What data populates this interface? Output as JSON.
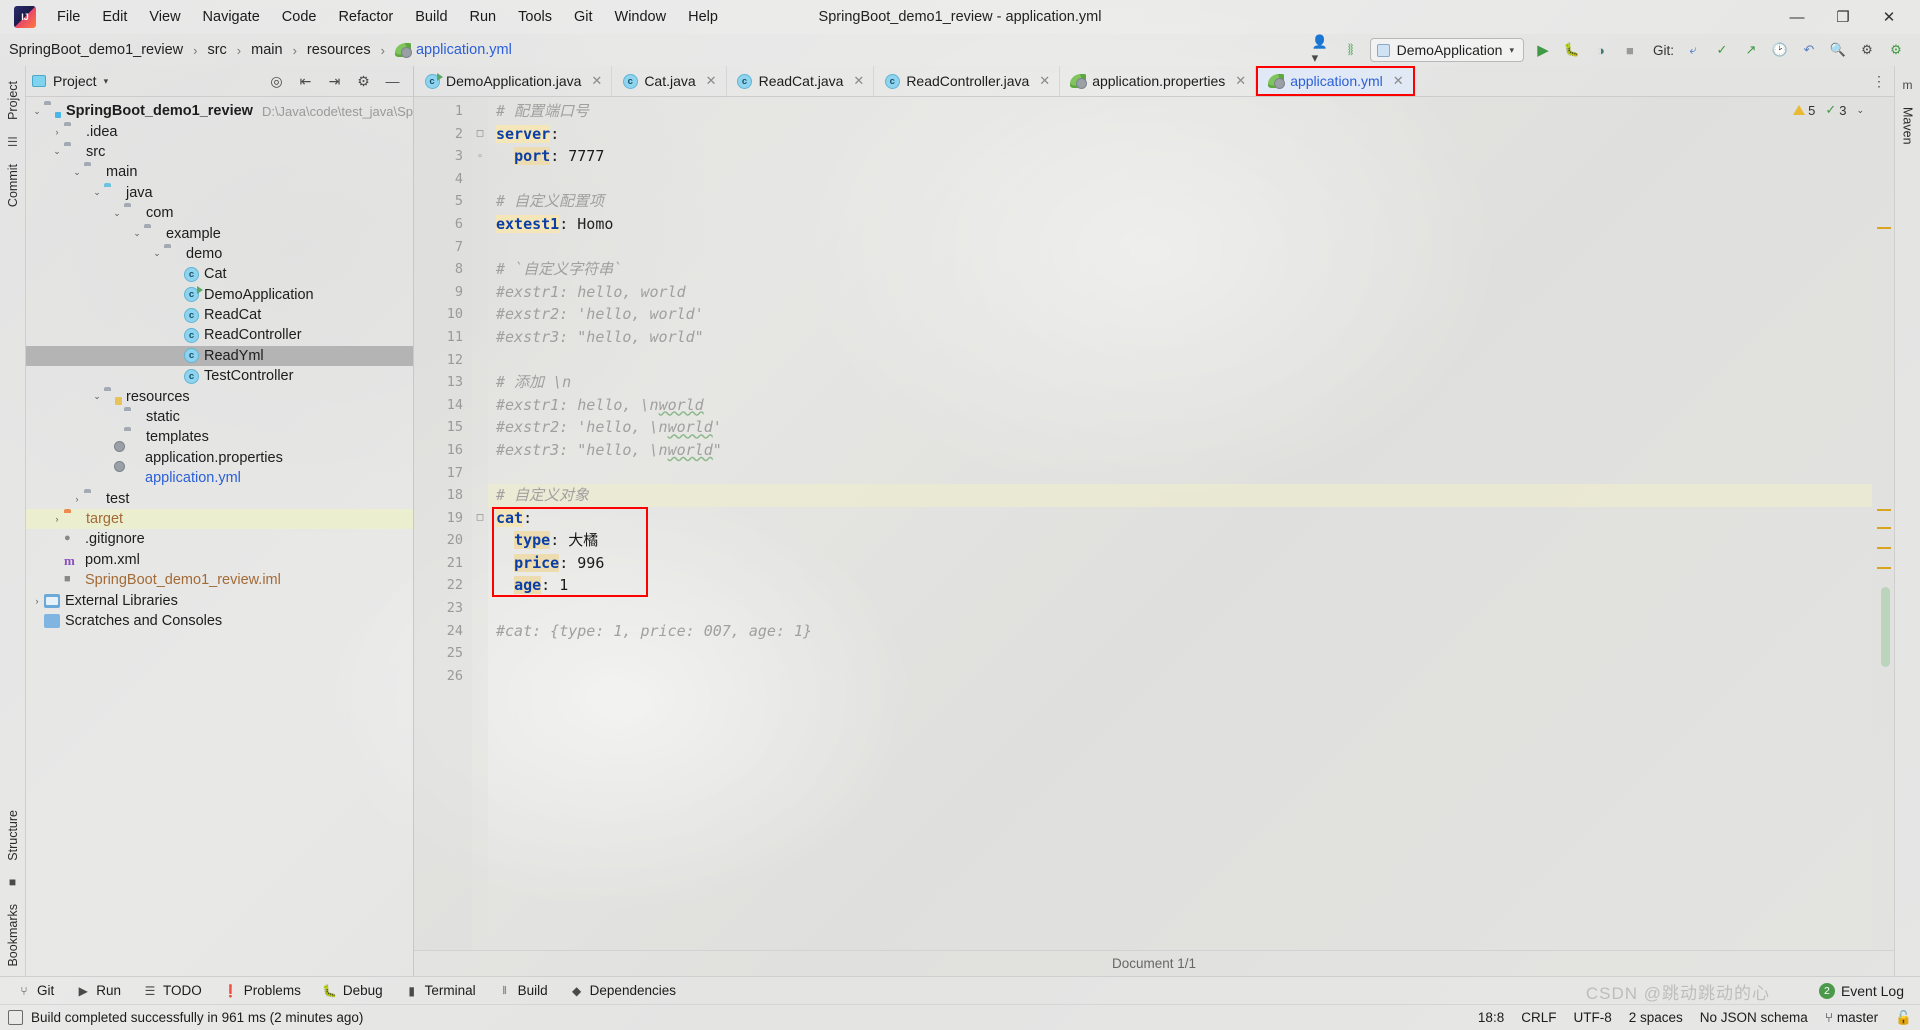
{
  "window": {
    "title": "SpringBoot_demo1_review - application.yml",
    "controls": {
      "minimize": "—",
      "maximize": "❐",
      "close": "✕"
    }
  },
  "menubar": {
    "logo": "idea-logo-icon",
    "items": [
      "File",
      "Edit",
      "View",
      "Navigate",
      "Code",
      "Refactor",
      "Build",
      "Run",
      "Tools",
      "Git",
      "Window",
      "Help"
    ]
  },
  "navbar": {
    "breadcrumbs": [
      {
        "label": "SpringBoot_demo1_review",
        "icon": "",
        "active": false
      },
      {
        "label": "src",
        "icon": "",
        "active": false
      },
      {
        "label": "main",
        "icon": "",
        "active": false
      },
      {
        "label": "resources",
        "icon": "",
        "active": false
      },
      {
        "label": "application.yml",
        "icon": "spring-leaf-icon",
        "active": true
      }
    ],
    "separator": "›",
    "profile_icon": "user-avatar-icon",
    "build_icon": "hammer-icon",
    "run_configuration": "DemoApplication",
    "run_icon": "run-play-icon",
    "debug_icon": "debug-bug-icon",
    "run_coverage_icon": "run-with-coverage-icon",
    "stop_icon": "stop-square-icon",
    "git_label": "Git:",
    "git_update_icon": "git-update-icon",
    "git_commit_icon": "git-commit-check-icon",
    "git_push_icon": "git-push-icon",
    "history_icon": "history-clock-icon",
    "undo_icon": "undo-arrow-icon",
    "search_icon": "search-magnifier-icon",
    "settings_icon": "gear-icon",
    "ide_icon": "ide-update-icon"
  },
  "left_rail": {
    "tabs": [
      "Project",
      "Commit"
    ],
    "bottom_tabs": [
      "Structure",
      "Bookmarks"
    ]
  },
  "right_rail": {
    "tabs": [
      "Maven"
    ]
  },
  "project_panel": {
    "title": "Project",
    "dropdown_icon": "chevron-down-icon",
    "header_icons": [
      "target-locate-icon",
      "expand-all-icon",
      "collapse-all-icon",
      "settings-gear-icon",
      "hide-panel-icon"
    ],
    "tree": [
      {
        "depth": 0,
        "arrow": "⌄",
        "icon": "folder-module",
        "label": "SpringBoot_demo1_review",
        "bold": true,
        "path": "D:\\Java\\code\\test_java\\SpringB…",
        "state": ""
      },
      {
        "depth": 1,
        "arrow": "›",
        "icon": "folder",
        "label": ".idea",
        "state": ""
      },
      {
        "depth": 1,
        "arrow": "⌄",
        "icon": "folder-src",
        "label": "src",
        "state": ""
      },
      {
        "depth": 2,
        "arrow": "⌄",
        "icon": "folder",
        "label": "main",
        "state": ""
      },
      {
        "depth": 3,
        "arrow": "⌄",
        "icon": "folder-blue",
        "label": "java",
        "state": ""
      },
      {
        "depth": 4,
        "arrow": "⌄",
        "icon": "folder",
        "label": "com",
        "state": ""
      },
      {
        "depth": 5,
        "arrow": "⌄",
        "icon": "folder",
        "label": "example",
        "state": ""
      },
      {
        "depth": 6,
        "arrow": "⌄",
        "icon": "folder",
        "label": "demo",
        "state": ""
      },
      {
        "depth": 7,
        "arrow": "",
        "icon": "java-class",
        "label": "Cat",
        "state": ""
      },
      {
        "depth": 7,
        "arrow": "",
        "icon": "java-class-runnable",
        "label": "DemoApplication",
        "state": ""
      },
      {
        "depth": 7,
        "arrow": "",
        "icon": "java-class",
        "label": "ReadCat",
        "state": ""
      },
      {
        "depth": 7,
        "arrow": "",
        "icon": "java-class",
        "label": "ReadController",
        "state": ""
      },
      {
        "depth": 7,
        "arrow": "",
        "icon": "java-class",
        "label": "ReadYml",
        "state": "selected"
      },
      {
        "depth": 7,
        "arrow": "",
        "icon": "java-class",
        "label": "TestController",
        "state": ""
      },
      {
        "depth": 3,
        "arrow": "⌄",
        "icon": "folder-resources",
        "label": "resources",
        "state": ""
      },
      {
        "depth": 4,
        "arrow": "",
        "icon": "folder",
        "label": "static",
        "state": ""
      },
      {
        "depth": 4,
        "arrow": "",
        "icon": "folder",
        "label": "templates",
        "state": ""
      },
      {
        "depth": 4,
        "arrow": "",
        "icon": "spring-leaf-icon",
        "label": "application.properties",
        "state": ""
      },
      {
        "depth": 4,
        "arrow": "",
        "icon": "spring-leaf-icon",
        "label": "application.yml",
        "state": "open-file"
      },
      {
        "depth": 2,
        "arrow": "›",
        "icon": "folder",
        "label": "test",
        "state": ""
      },
      {
        "depth": 1,
        "arrow": "›",
        "icon": "folder-orange",
        "label": "target",
        "state": "excluded"
      },
      {
        "depth": 1,
        "arrow": "",
        "icon": "gitignore-icon",
        "label": ".gitignore",
        "state": ""
      },
      {
        "depth": 1,
        "arrow": "",
        "icon": "maven-icon",
        "label": "pom.xml",
        "state": ""
      },
      {
        "depth": 1,
        "arrow": "",
        "icon": "iml-icon",
        "label": "SpringBoot_demo1_review.iml",
        "state": "module-file"
      },
      {
        "depth": 0,
        "arrow": "›",
        "icon": "library-icon",
        "label": "External Libraries",
        "state": ""
      },
      {
        "depth": 0,
        "arrow": "",
        "icon": "scratches-icon",
        "label": "Scratches and Consoles",
        "state": ""
      }
    ]
  },
  "editor": {
    "tabs": [
      {
        "label": "DemoApplication.java",
        "icon": "java-class-runnable",
        "selected": false
      },
      {
        "label": "Cat.java",
        "icon": "java-class",
        "selected": false
      },
      {
        "label": "ReadCat.java",
        "icon": "java-class",
        "selected": false
      },
      {
        "label": "ReadController.java",
        "icon": "java-class",
        "selected": false
      },
      {
        "label": "application.properties",
        "icon": "spring-leaf-icon",
        "selected": false
      },
      {
        "label": "application.yml",
        "icon": "spring-leaf-icon",
        "selected": true
      }
    ],
    "close_icon": "✕",
    "more_tabs_icon": "⋮",
    "inspection": {
      "warnings": "5",
      "weak_warnings": "3",
      "warn_icon": "warning-triangle-icon",
      "check_icon": "inspection-check-icon",
      "chevron": "⌄"
    },
    "document_status": "Document 1/1",
    "lines": [
      {
        "n": 1,
        "text": "# 配置端口号",
        "type": "comment",
        "highlight": false
      },
      {
        "n": 2,
        "text": "server:",
        "type": "key",
        "highlight": false
      },
      {
        "n": 3,
        "text": "  port: 7777",
        "type": "keyvalue",
        "highlight": false
      },
      {
        "n": 4,
        "text": "",
        "type": "blank",
        "highlight": false
      },
      {
        "n": 5,
        "text": "# 自定义配置项",
        "type": "comment",
        "highlight": false
      },
      {
        "n": 6,
        "text": "extest1: Homo",
        "type": "keyvalue-marked",
        "highlight": false
      },
      {
        "n": 7,
        "text": "",
        "type": "blank",
        "highlight": false
      },
      {
        "n": 8,
        "text": "# `自定义字符串`",
        "type": "comment",
        "highlight": false
      },
      {
        "n": 9,
        "text": "#exstr1: hello, world",
        "type": "comment",
        "highlight": false
      },
      {
        "n": 10,
        "text": "#exstr2: 'hello, world'",
        "type": "comment",
        "highlight": false
      },
      {
        "n": 11,
        "text": "#exstr3: \"hello, world\"",
        "type": "comment",
        "highlight": false
      },
      {
        "n": 12,
        "text": "",
        "type": "blank",
        "highlight": false
      },
      {
        "n": 13,
        "text": "# 添加 \\n",
        "type": "comment",
        "highlight": false
      },
      {
        "n": 14,
        "text": "#exstr1: hello, \\nworld",
        "type": "comment",
        "highlight": false
      },
      {
        "n": 15,
        "text": "#exstr2: 'hello, \\nworld'",
        "type": "comment",
        "highlight": false
      },
      {
        "n": 16,
        "text": "#exstr3: \"hello, \\nworld\"",
        "type": "comment",
        "highlight": false
      },
      {
        "n": 17,
        "text": "",
        "type": "blank",
        "highlight": false
      },
      {
        "n": 18,
        "text": "# 自定义对象",
        "type": "comment",
        "highlight": true
      },
      {
        "n": 19,
        "text": "cat:",
        "type": "key",
        "highlight": false
      },
      {
        "n": 20,
        "text": "  type: 大橘",
        "type": "keyvalue",
        "highlight": false
      },
      {
        "n": 21,
        "text": "  price: 996",
        "type": "keyvalue",
        "highlight": false
      },
      {
        "n": 22,
        "text": "  age: 1",
        "type": "keyvalue",
        "highlight": false
      },
      {
        "n": 23,
        "text": "",
        "type": "blank",
        "highlight": false
      },
      {
        "n": 24,
        "text": "#cat: {type: 1, price: 007, age: 1}",
        "type": "comment",
        "highlight": false
      },
      {
        "n": 25,
        "text": "",
        "type": "blank",
        "highlight": false
      },
      {
        "n": 26,
        "text": "",
        "type": "blank",
        "highlight": false
      }
    ]
  },
  "bottom_bar": {
    "items": [
      {
        "label": "Git",
        "icon": "git-branch-icon"
      },
      {
        "label": "Run",
        "icon": "run-play-icon"
      },
      {
        "label": "TODO",
        "icon": "todo-list-icon"
      },
      {
        "label": "Problems",
        "icon": "problems-icon"
      },
      {
        "label": "Debug",
        "icon": "debug-bug-icon"
      },
      {
        "label": "Terminal",
        "icon": "terminal-icon"
      },
      {
        "label": "Build",
        "icon": "hammer-icon"
      },
      {
        "label": "Dependencies",
        "icon": "dependencies-icon"
      }
    ],
    "event_log": {
      "label": "Event Log",
      "count": "2"
    }
  },
  "statusbar": {
    "icon": "message-icon",
    "message": "Build completed successfully in 961 ms (2 minutes ago)",
    "right": [
      "18:8",
      "CRLF",
      "UTF-8",
      "2 spaces",
      "No JSON schema"
    ],
    "branch": "master",
    "branch_icon": "git-branch-icon",
    "lock_icon": "unlocked-padlock-icon",
    "watermark": "CSDN @跳动跳动的心"
  },
  "colors": {
    "accent_blue": "#2b5fd9",
    "selection_red": "#ff0000",
    "marked_yellow": "#f4e6b8",
    "spring_green": "#5da83f",
    "warning_yellow": "#e8b931",
    "ok_green": "#3f9a43"
  }
}
